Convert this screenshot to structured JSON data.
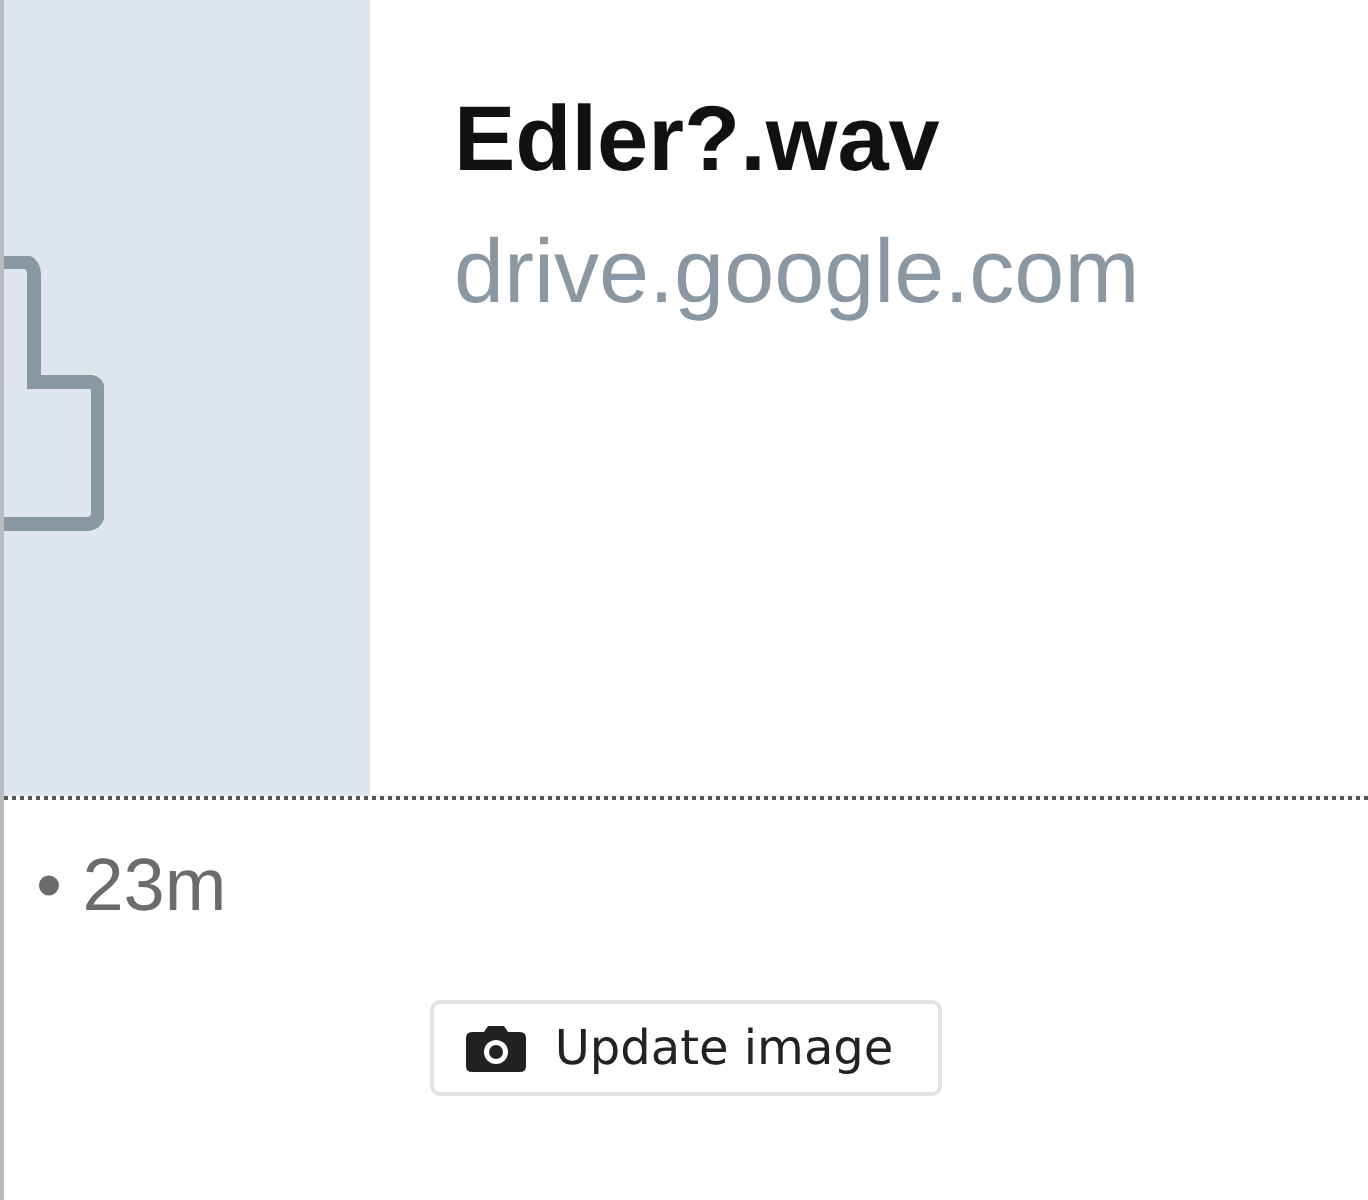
{
  "link_preview": {
    "title": "Edler?.wav",
    "domain": "drive.google.com"
  },
  "meta": "• 23m",
  "update_button": {
    "label": "Update image"
  }
}
